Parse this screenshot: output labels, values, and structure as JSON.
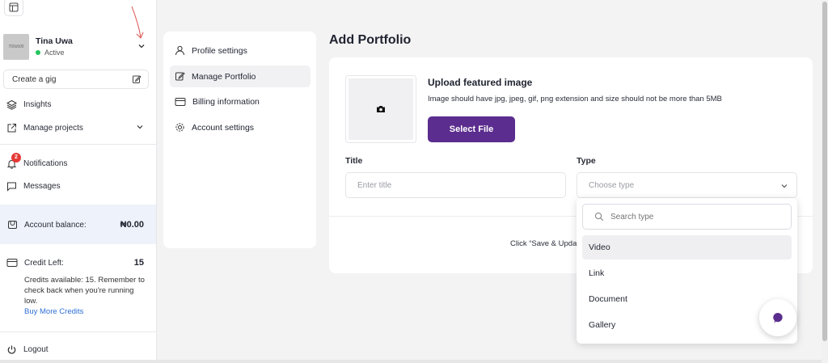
{
  "sidebar": {
    "profile": {
      "avatar_text": "700x500",
      "name": "Tina Uwa",
      "status": "Active"
    },
    "create_gig": "Create a gig",
    "nav": {
      "insights": "Insights",
      "manage_projects": "Manage projects",
      "notifications": "Notifications",
      "notifications_count": "2",
      "messages": "Messages"
    },
    "account_balance": {
      "label": "Account balance:",
      "value": "₦0.00"
    },
    "credit": {
      "label": "Credit Left:",
      "value": "15",
      "description": "Credits available: 15. Remember to check back when you're running low.",
      "buy_link": "Buy More Credits"
    },
    "logout": "Logout"
  },
  "settings_menu": {
    "items": [
      "Profile settings",
      "Manage Portfolio",
      "Billing information",
      "Account settings"
    ]
  },
  "main": {
    "title": "Add Portfolio",
    "upload": {
      "title": "Upload featured image",
      "description": "Image should have jpg, jpeg, gif, png extension and size should not be more than 5MB",
      "button": "Select File"
    },
    "title_field": {
      "label": "Title",
      "placeholder": "Enter title"
    },
    "type_field": {
      "label": "Type",
      "placeholder": "Choose type"
    },
    "save_hint": "Click “Save & Upda"
  },
  "type_dropdown": {
    "search_placeholder": "Search type",
    "options": [
      "Video",
      "Link",
      "Document",
      "Gallery"
    ]
  },
  "colors": {
    "accent": "#5b2d8e",
    "badge": "#e53935",
    "active_dot": "#22c55e",
    "link": "#2f6fd6"
  }
}
